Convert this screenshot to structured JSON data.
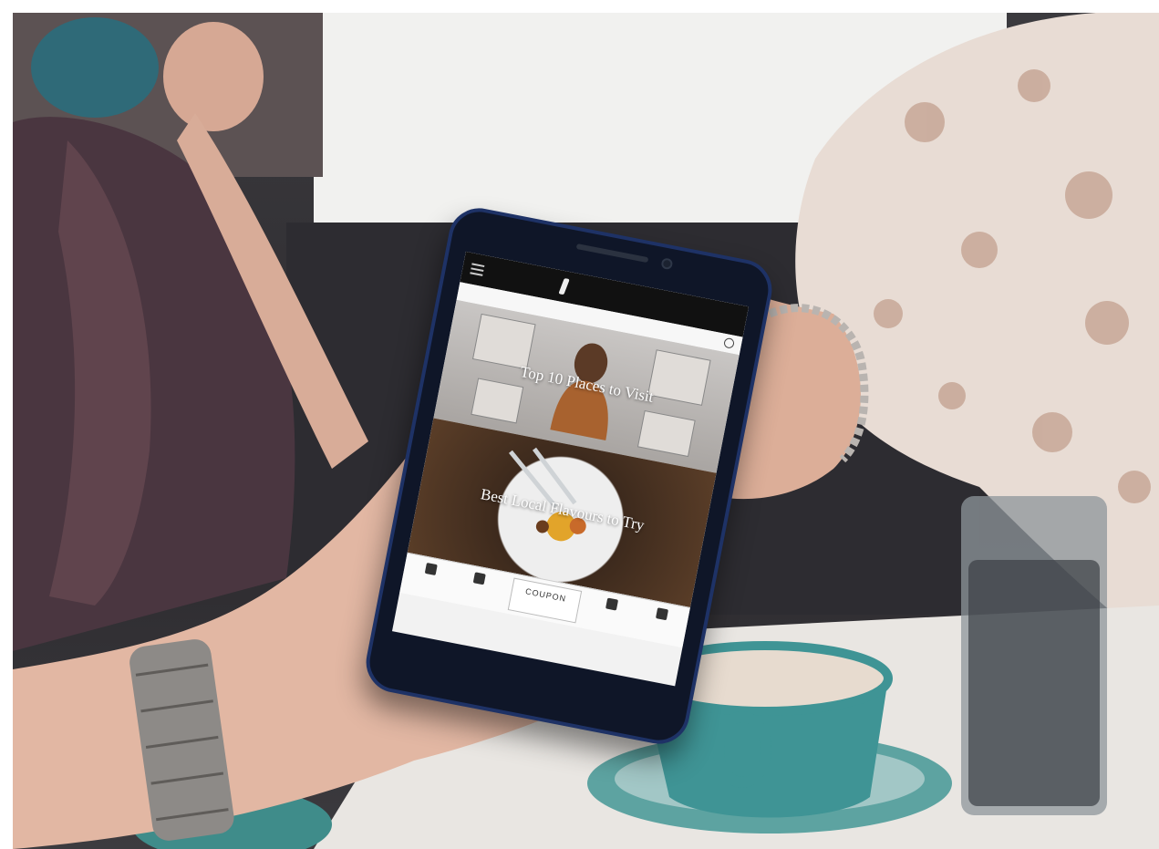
{
  "phone_app": {
    "topbar": {
      "logo_text": "",
      "status_text": ""
    },
    "tabs": [],
    "cards": [
      {
        "title": "Top 10 Places to Visit"
      },
      {
        "title": "Best Local Flavours to Try"
      }
    ],
    "bottom_nav": {
      "center_label": "COUPON"
    }
  }
}
